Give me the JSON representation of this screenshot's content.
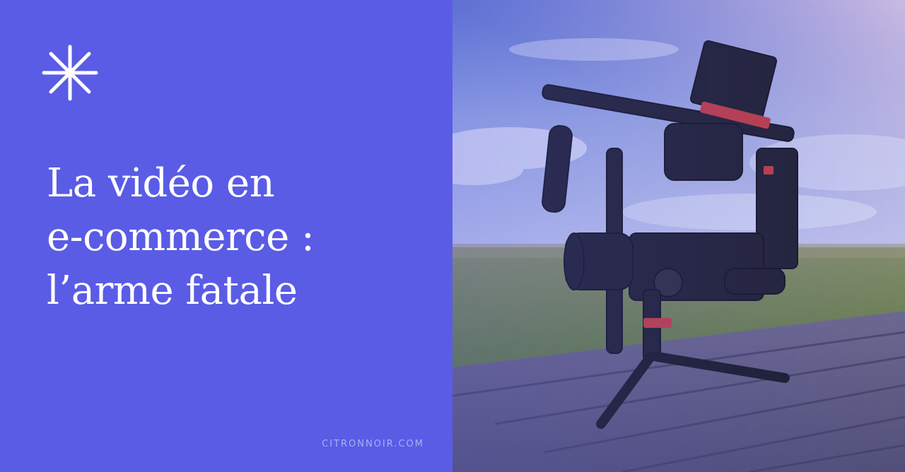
{
  "title_lines": [
    "La vidéo en",
    "e-commerce :",
    "l’arme fatale"
  ],
  "site_label": "CITRONNOIR.COM",
  "icons": {
    "brand_mark": "asterisk-icon"
  },
  "colors": {
    "panel_bg": "#5a5ce6",
    "title_text": "#ffffff",
    "site_text": "#a9b0ee"
  },
  "photo": {
    "subject": "camera-gimbal-on-wooden-deck",
    "alt_text": ""
  }
}
